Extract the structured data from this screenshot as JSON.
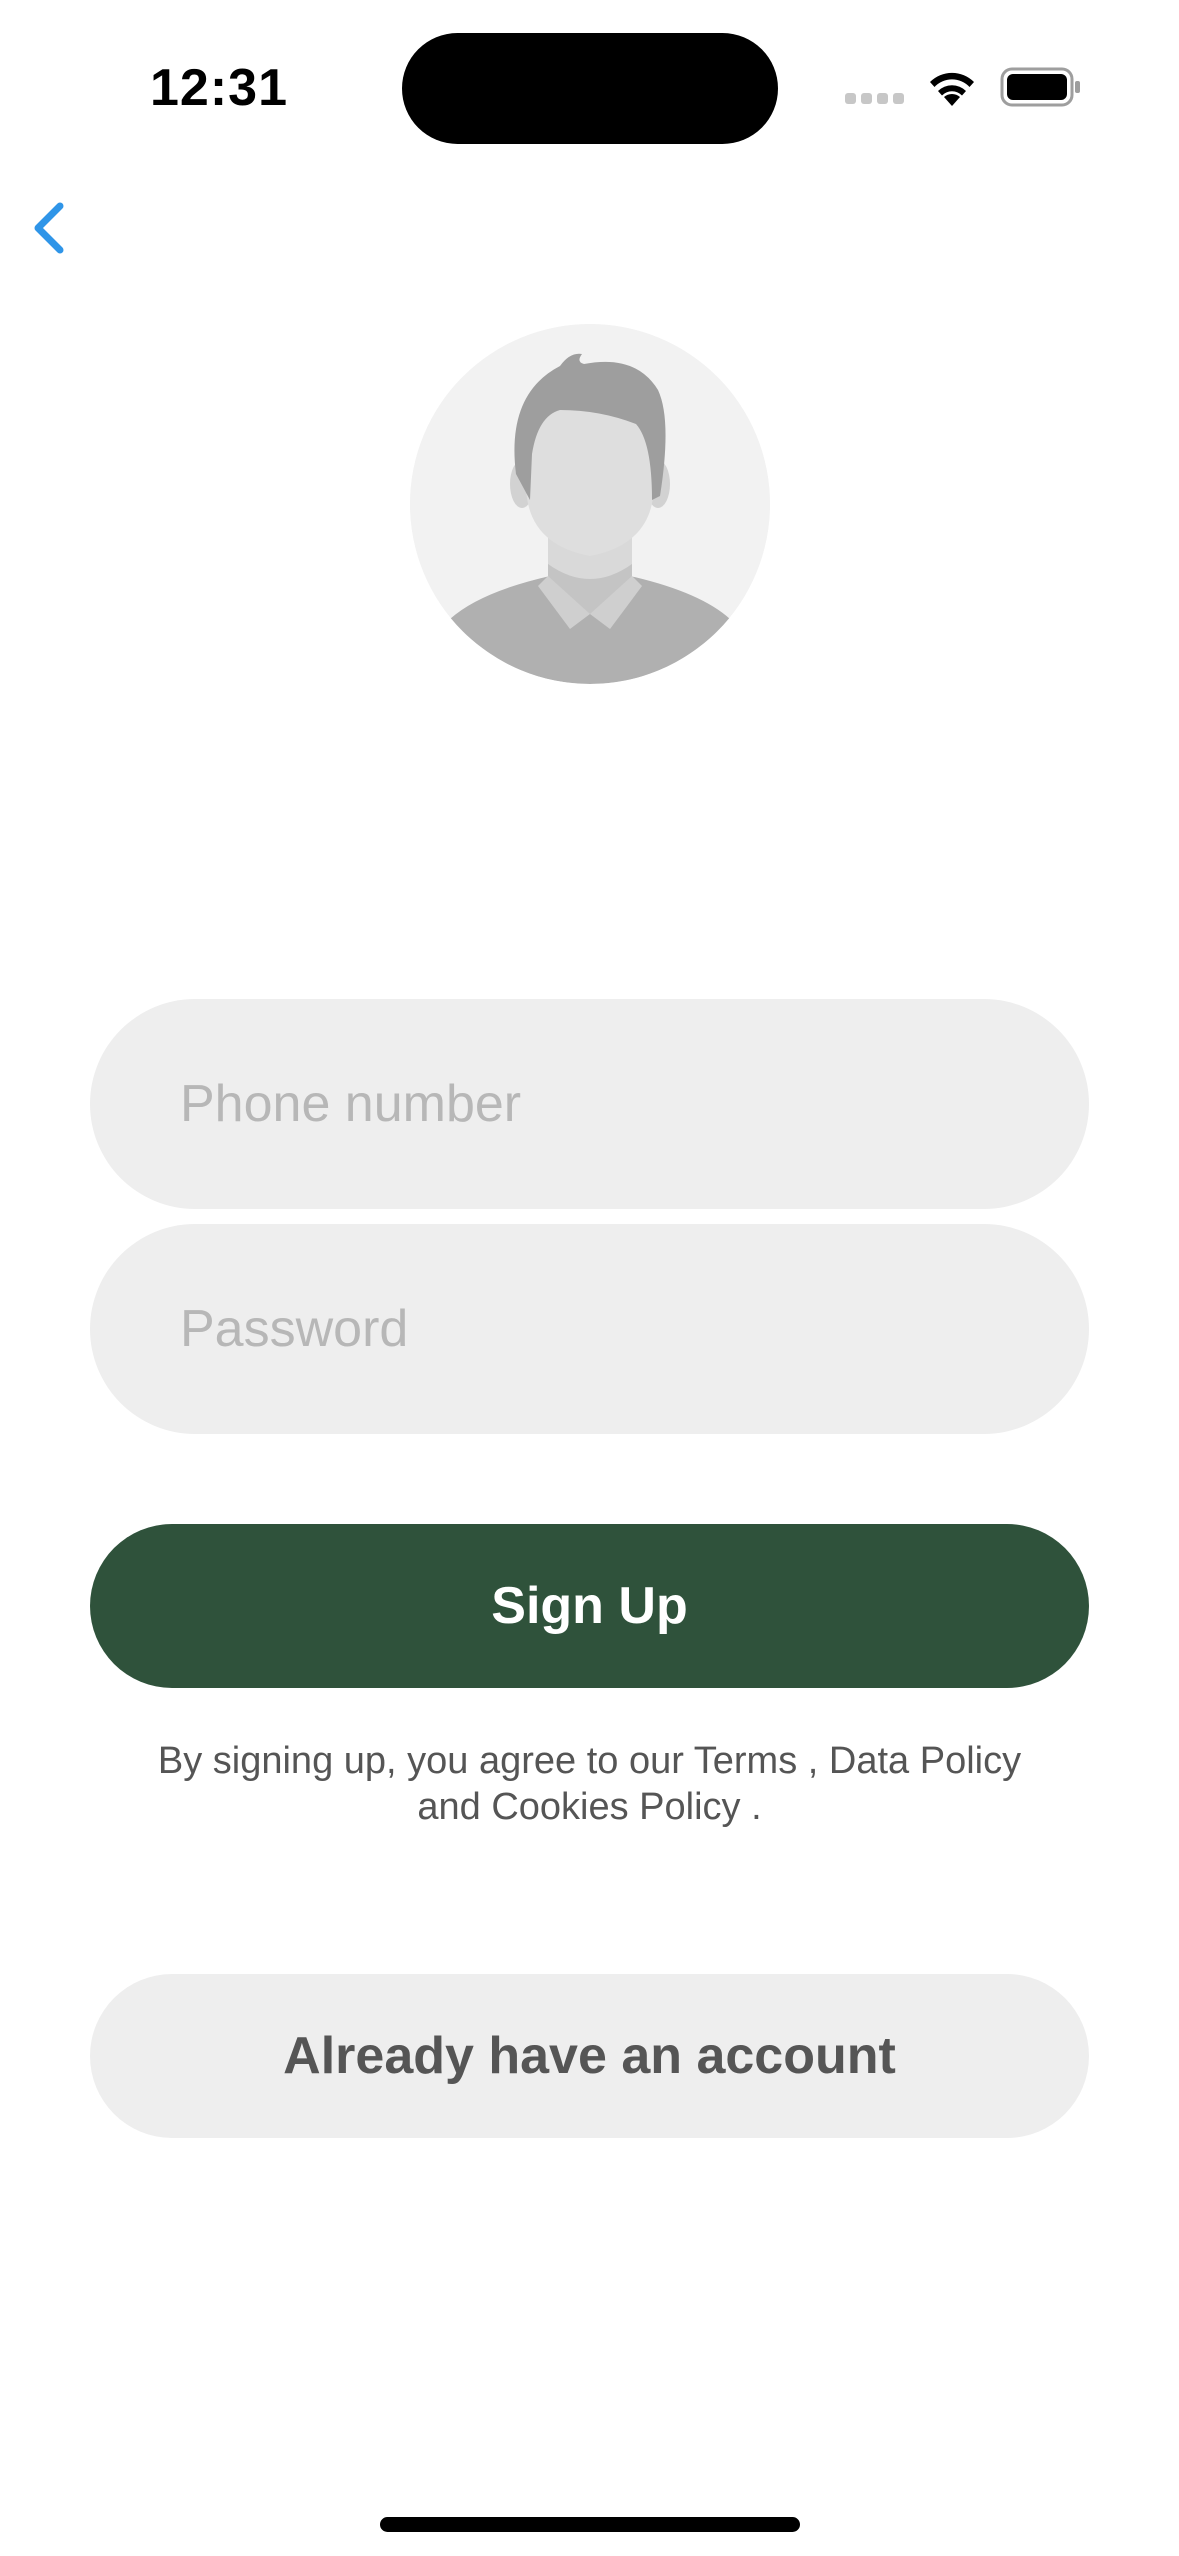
{
  "status_bar": {
    "time": "12:31"
  },
  "navigation": {
    "back_icon": "chevron-left-icon"
  },
  "profile": {
    "avatar_icon": "person-placeholder-icon"
  },
  "form": {
    "phone_placeholder": "Phone number",
    "phone_value": "",
    "password_placeholder": "Password",
    "password_value": ""
  },
  "signup_button_label": "Sign Up",
  "terms": {
    "prefix": "By signing up, you agree to our ",
    "terms_link": "Terms",
    "separator": " , ",
    "data_policy_link": "Data Policy",
    "and_text": "and ",
    "cookies_link": "Cookies Policy",
    "suffix": " ."
  },
  "login_button_label": "Already have an account",
  "colors": {
    "primary_button": "#2f523b",
    "back_icon": "#2f95e8",
    "field_background": "#eeeeee"
  }
}
